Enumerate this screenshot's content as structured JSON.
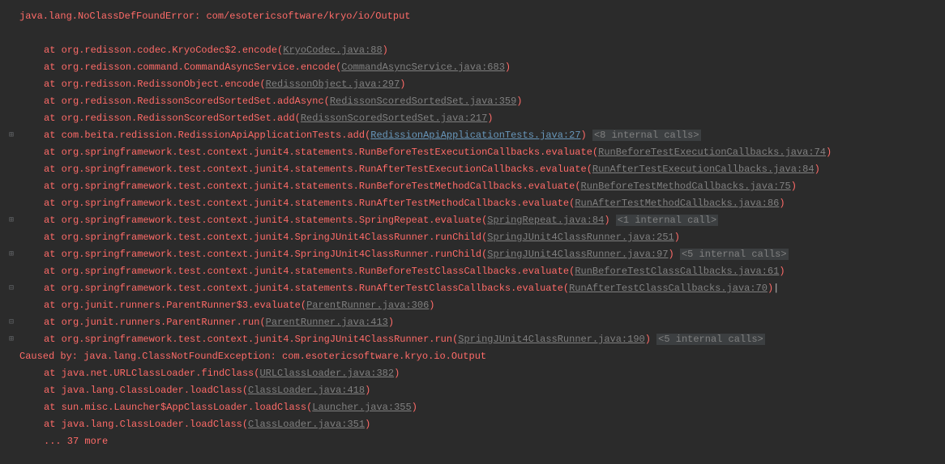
{
  "error_header": "java.lang.NoClassDefFoundError: com/esotericsoftware/kryo/io/Output",
  "caused_by": "Caused by: java.lang.ClassNotFoundException: com.esotericsoftware.kryo.io.Output",
  "more_frames": "... 37 more",
  "gutter": {
    "expand": "⊞",
    "collapse": "⊟",
    "wrap": "⊟"
  },
  "lines": [
    {
      "at": "at org.redisson.codec.KryoCodec$2.encode",
      "open": "(",
      "link": "KryoCodec.java:88",
      "close": ")",
      "link_cls": "muted-link"
    },
    {
      "at": "at org.redisson.command.CommandAsyncService.encode",
      "open": "(",
      "link": "CommandAsyncService.java:683",
      "close": ")",
      "link_cls": "muted-link"
    },
    {
      "at": "at org.redisson.RedissonObject.encode",
      "open": "(",
      "link": "RedissonObject.java:297",
      "close": ")",
      "link_cls": "muted-link"
    },
    {
      "at": "at org.redisson.RedissonScoredSortedSet.addAsync",
      "open": "(",
      "link": "RedissonScoredSortedSet.java:359",
      "close": ")",
      "link_cls": "muted-link"
    },
    {
      "at": "at org.redisson.RedissonScoredSortedSet.add",
      "open": "(",
      "link": "RedissonScoredSortedSet.java:217",
      "close": ")",
      "link_cls": "muted-link"
    },
    {
      "at": "at com.beita.redission.RedissionApiApplicationTests.add",
      "open": "(",
      "link": "RedissionApiApplicationTests.java:27",
      "close": ")",
      "link_cls": "link",
      "suffix": "<8 internal calls>",
      "gutter": "expand"
    },
    {
      "at": "at org.springframework.test.context.junit4.statements.RunBeforeTestExecutionCallbacks.evaluate",
      "open": "(",
      "link": "RunBeforeTestExecutionCallbacks.java:74",
      "close": ")",
      "link_cls": "muted-link"
    },
    {
      "at": "at org.springframework.test.context.junit4.statements.RunAfterTestExecutionCallbacks.evaluate",
      "open": "(",
      "link": "RunAfterTestExecutionCallbacks.java:84",
      "close": ")",
      "link_cls": "muted-link"
    },
    {
      "at": "at org.springframework.test.context.junit4.statements.RunBeforeTestMethodCallbacks.evaluate",
      "open": "(",
      "link": "RunBeforeTestMethodCallbacks.java:75",
      "close": ")",
      "link_cls": "muted-link"
    },
    {
      "at": "at org.springframework.test.context.junit4.statements.RunAfterTestMethodCallbacks.evaluate",
      "open": "(",
      "link": "RunAfterTestMethodCallbacks.java:86",
      "close": ")",
      "link_cls": "muted-link"
    },
    {
      "at": "at org.springframework.test.context.junit4.statements.SpringRepeat.evaluate",
      "open": "(",
      "link": "SpringRepeat.java:84",
      "close": ")",
      "link_cls": "muted-link",
      "suffix": "<1 internal call>",
      "gutter": "expand"
    },
    {
      "at": "at org.springframework.test.context.junit4.SpringJUnit4ClassRunner.runChild",
      "open": "(",
      "link": "SpringJUnit4ClassRunner.java:251",
      "close": ")",
      "link_cls": "muted-link"
    },
    {
      "at": "at org.springframework.test.context.junit4.SpringJUnit4ClassRunner.runChild",
      "open": "(",
      "link": "SpringJUnit4ClassRunner.java:97",
      "close": ")",
      "link_cls": "muted-link",
      "suffix": "<5 internal calls>",
      "gutter": "expand"
    },
    {
      "at": "at org.springframework.test.context.junit4.statements.RunBeforeTestClassCallbacks.evaluate",
      "open": "(",
      "link": "RunBeforeTestClassCallbacks.java:61",
      "close": ")",
      "link_cls": "muted-link"
    },
    {
      "at": "at org.springframework.test.context.junit4.statements.RunAfterTestClassCallbacks.evaluate",
      "open": "(",
      "link": "RunAfterTestClassCallbacks.java:70",
      "close": ")",
      "link_cls": "muted-link",
      "cursor": true,
      "gutter": "wrap"
    },
    {
      "at": "at org.junit.runners.ParentRunner$3.evaluate",
      "open": "(",
      "link": "ParentRunner.java:306",
      "close": ")",
      "link_cls": "muted-link"
    },
    {
      "at": "at org.junit.runners.ParentRunner.run",
      "open": "(",
      "link": "ParentRunner.java:413",
      "close": ")",
      "link_cls": "muted-link",
      "gutter": "collapse"
    },
    {
      "at": "at org.springframework.test.context.junit4.SpringJUnit4ClassRunner.run",
      "open": "(",
      "link": "SpringJUnit4ClassRunner.java:190",
      "close": ")",
      "link_cls": "muted-link",
      "suffix": "<5 internal calls>",
      "gutter": "expand"
    }
  ],
  "cause_lines": [
    {
      "at": "at java.net.URLClassLoader.findClass",
      "open": "(",
      "link": "URLClassLoader.java:382",
      "close": ")",
      "link_cls": "muted-link"
    },
    {
      "at": "at java.lang.ClassLoader.loadClass",
      "open": "(",
      "link": "ClassLoader.java:418",
      "close": ")",
      "link_cls": "muted-link"
    },
    {
      "at": "at sun.misc.Launcher$AppClassLoader.loadClass",
      "open": "(",
      "link": "Launcher.java:355",
      "close": ")",
      "link_cls": "muted-link"
    },
    {
      "at": "at java.lang.ClassLoader.loadClass",
      "open": "(",
      "link": "ClassLoader.java:351",
      "close": ")",
      "link_cls": "muted-link"
    }
  ]
}
